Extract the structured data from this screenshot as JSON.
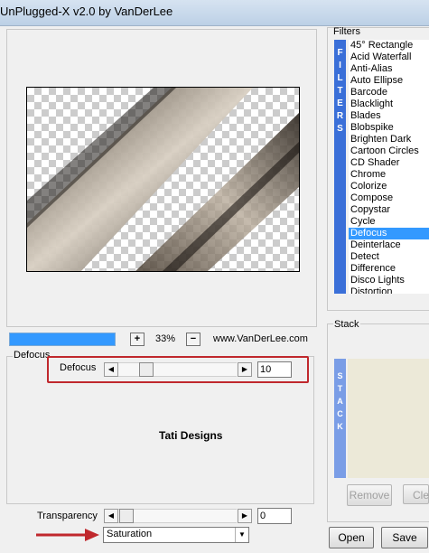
{
  "window": {
    "title": "UnPlugged-X v2.0 by VanDerLee"
  },
  "preview": {
    "zoom": "33%",
    "site": "www.VanDerLee.com",
    "zoom_in": "+",
    "zoom_out": "−",
    "progress": 1.0
  },
  "filter_group": {
    "label": "Defocus",
    "param_label": "Defocus",
    "param_value": "10",
    "credit": "Tati Designs"
  },
  "bottom": {
    "transparency_label": "Transparency",
    "transparency_value": "0",
    "mode": "Saturation"
  },
  "filters": {
    "title": "Filters",
    "bar_text": "FILTERS",
    "items": [
      "45° Rectangle",
      "Acid Waterfall",
      "Anti-Alias",
      "Auto Ellipse",
      "Barcode",
      "Blacklight",
      "Blades",
      "Blobspike",
      "Brighten Dark",
      "Cartoon Circles",
      "CD Shader",
      "Chrome",
      "Colorize",
      "Compose",
      "Copystar",
      "Cycle",
      "Defocus",
      "Deinterlace",
      "Detect",
      "Difference",
      "Disco Lights",
      "Distortion"
    ],
    "selected": "Defocus"
  },
  "stack": {
    "title": "Stack",
    "bar_text": "STACK",
    "remove": "Remove",
    "clear": "Clea"
  },
  "buttons": {
    "open": "Open",
    "save": "Save"
  },
  "colors": {
    "accent": "#3399ff",
    "annotation": "#c0282d"
  }
}
